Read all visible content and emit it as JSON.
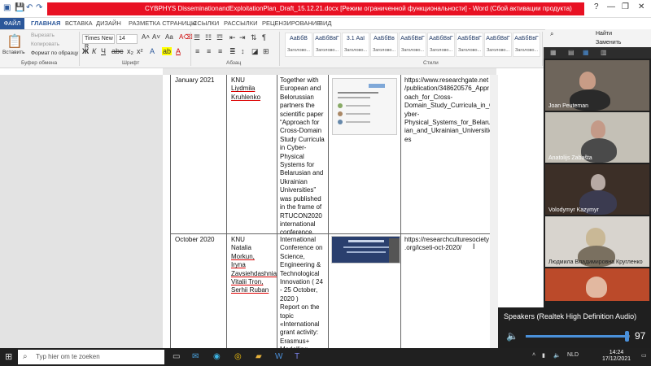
{
  "window": {
    "title": "CYBPHYS DisseminationandExploitationPlan_Draft_15.12.21.docx [Режим ограниченной функциональности] - Word (Сбой активации продукта)",
    "title_bar_color": "#e81123",
    "controls": {
      "help": "?",
      "minimize": "—",
      "restore": "❐",
      "close": "✕"
    }
  },
  "ribbon": {
    "tabs": [
      "ФАЙЛ",
      "ГЛАВНАЯ",
      "ВСТАВКА",
      "ДИЗАЙН",
      "РАЗМЕТКА СТРАНИЦЫ",
      "ССЫЛКИ",
      "РАССЫЛКИ",
      "РЕЦЕНЗИРОВАНИЕ",
      "ВИД"
    ],
    "active_tab": "ГЛАВНАЯ",
    "clipboard": {
      "paste": "Вставить",
      "cut": "Вырезать",
      "copy": "Копировать",
      "format_painter": "Формат по образцу",
      "group": "Буфер обмена"
    },
    "font": {
      "name": "Times New R",
      "size": "14",
      "group": "Шрифт"
    },
    "paragraph": {
      "group": "Абзац"
    },
    "styles": {
      "items": [
        {
          "preview": "АаБбВ",
          "caption": "Заголово..."
        },
        {
          "preview": "АаБбВвГ",
          "caption": "Заголово..."
        },
        {
          "preview": "3.1  АаI",
          "caption": "Заголово..."
        },
        {
          "preview": "АаБбВв",
          "caption": "Заголово..."
        },
        {
          "preview": "АаБбВвГ",
          "caption": "Заголово..."
        },
        {
          "preview": "АаБбВвГ",
          "caption": "Заголово..."
        },
        {
          "preview": "АаБбВвГ",
          "caption": "Заголово..."
        },
        {
          "preview": "АаБбВвГ",
          "caption": "Заголово..."
        },
        {
          "preview": "АаБбВвГ",
          "caption": "Заголово..."
        }
      ],
      "group": "Стили"
    },
    "editing": {
      "find": "Найти",
      "replace": "Заменить"
    },
    "accent": "#2b579a"
  },
  "document": {
    "rows": [
      {
        "date": "January 2021",
        "org": "KNU",
        "people": [
          "Liydmila",
          "Kruhlenko"
        ],
        "activity": [
          "Together with",
          "European and",
          "Belorussian",
          "partners the",
          "scientific paper",
          "“Approach for",
          "Cross-Domain",
          "Study Curricula",
          "in Cyber-",
          "Physical",
          "Systems for",
          "Belarusian and",
          "Ukrainian",
          "Universities”",
          "was published",
          "in the frame of",
          "RTUCON2020",
          "international",
          "conference."
        ],
        "link": [
          "https://www.researchgate.net",
          "/publication/348620576_Appr",
          "oach_for_Cross-",
          "Domain_Study_Curricula_in_C",
          "yber-",
          "Physical_Systems_for_Belarus",
          "ian_and_Ukrainian_Universities",
          "es"
        ]
      },
      {
        "date": "October 2020",
        "org": "KNU",
        "people": [
          "Natalia",
          "Morkun,",
          "Iryna",
          "Zavsiehdashnia",
          "Vitalii Tron,",
          "Serhii Ruban"
        ],
        "activity": [
          "International",
          "Conference on",
          "Science,",
          "Engineering &",
          "Technological",
          "Innovation ( 24",
          "-  25   October,",
          "2020 )",
          "Report on the",
          "topic",
          "«International",
          "grant activity:",
          "Erasmus+",
          "Modelling"
        ],
        "link": [
          "https://researchculturesociety",
          ".org/icseti-oct-2020/"
        ]
      }
    ]
  },
  "teams": {
    "participants": [
      {
        "name": "Joan Peuteman"
      },
      {
        "name": "Anatolijs Zabašta"
      },
      {
        "name": "Volodymyr Kazymyr"
      },
      {
        "name": "Людмила Владимировна Кругленко"
      },
      {
        "name": ""
      }
    ]
  },
  "audio_popup": {
    "device": "Speakers (Realtek High Definition Audio)",
    "volume": "97",
    "volume_fraction": 0.97,
    "speaker_icon": "🔈"
  },
  "taskbar": {
    "search_placeholder": "Typ hier om te zoeken",
    "language": "NLD",
    "time": "14:24",
    "date": "17/12/2021",
    "apps": [
      "task-view-icon",
      "mail-icon",
      "edge-icon",
      "chrome-icon",
      "explorer-icon",
      "word-icon",
      "teams-icon"
    ]
  }
}
